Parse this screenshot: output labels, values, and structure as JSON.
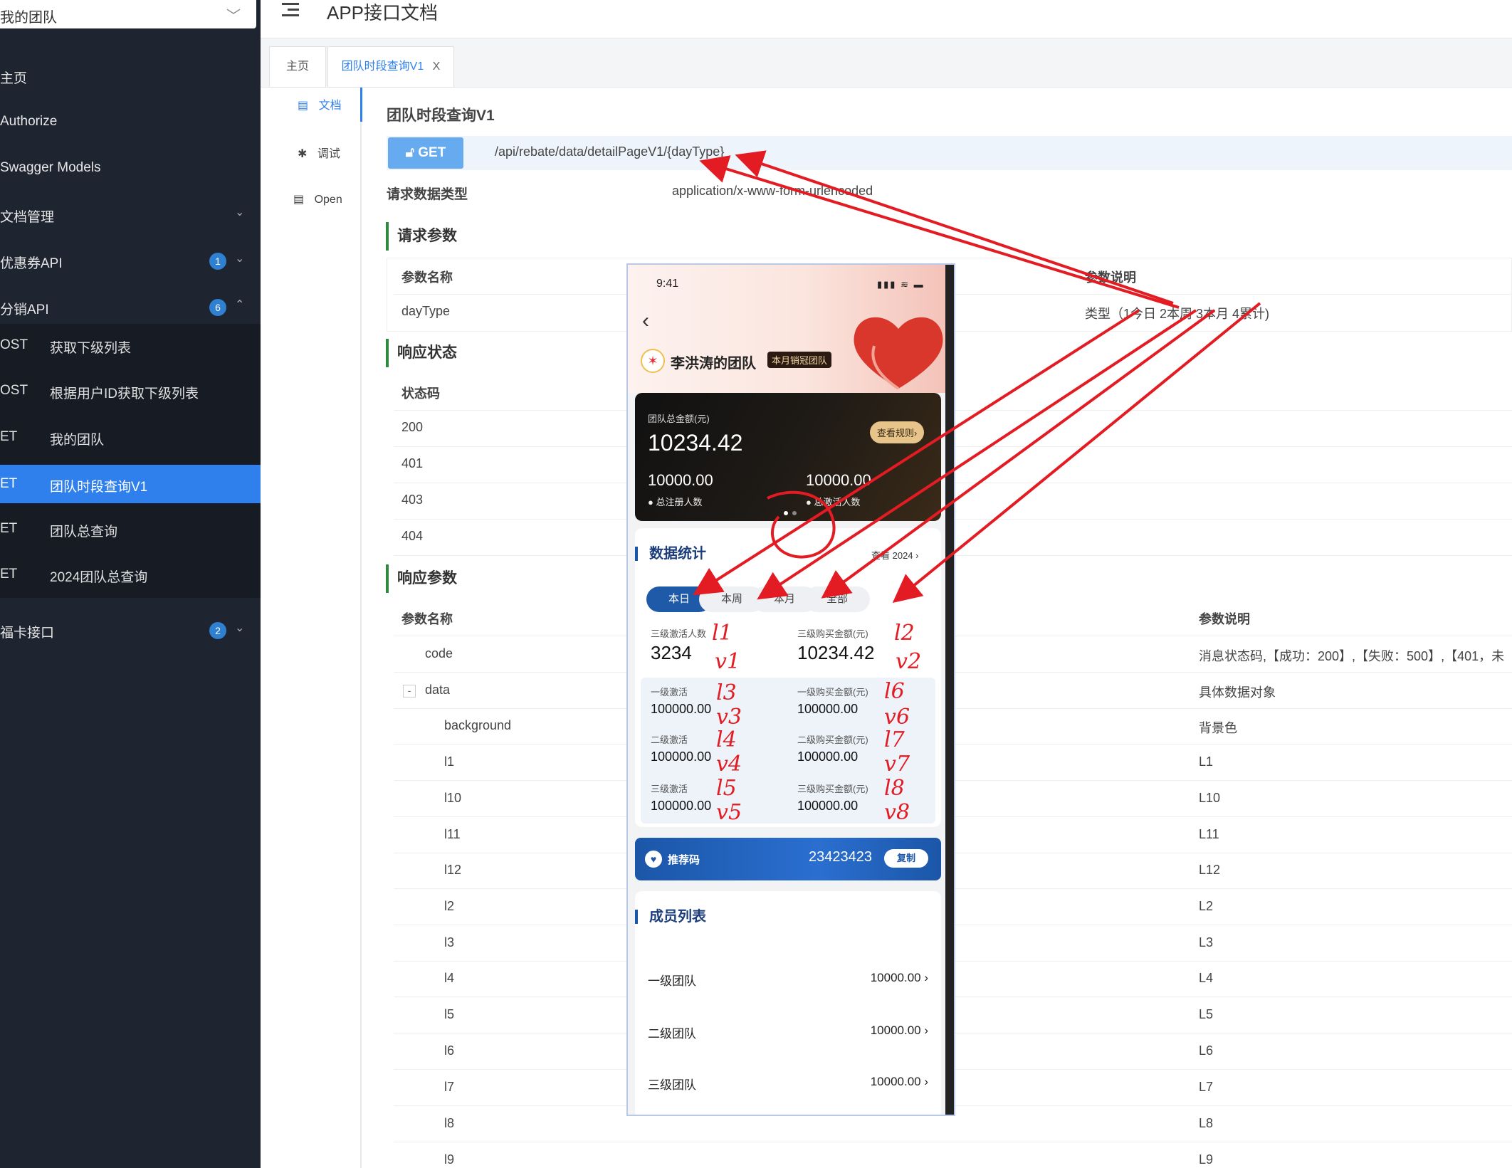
{
  "sidebar": {
    "team_select": "我的团队",
    "items": [
      {
        "label": "主页"
      },
      {
        "label": "Authorize"
      },
      {
        "label": "Swagger Models"
      },
      {
        "label": "文档管理"
      },
      {
        "label": "优惠券API",
        "badge": "1"
      },
      {
        "label": "分销API",
        "badge": "6"
      },
      {
        "label": "福卡接口",
        "badge": "2"
      }
    ],
    "sub_items": [
      {
        "method": "OST",
        "label": "获取下级列表"
      },
      {
        "method": "OST",
        "label": "根据用户ID获取下级列表"
      },
      {
        "method": "ET",
        "label": "我的团队"
      },
      {
        "method": "ET",
        "label": "团队时段查询V1"
      },
      {
        "method": "ET",
        "label": "团队总查询"
      },
      {
        "method": "ET",
        "label": "2024团队总查询"
      }
    ]
  },
  "header": {
    "title": "APP接口文档"
  },
  "tabs": [
    {
      "label": "主页"
    },
    {
      "label": "团队时段查询V1"
    }
  ],
  "tab_close": "X",
  "doc_menu": [
    {
      "icon": "▤",
      "label": "文档"
    },
    {
      "icon": "✱",
      "label": "调试"
    },
    {
      "icon": "▤",
      "label": "Open"
    }
  ],
  "main": {
    "title": "团队时段查询V1",
    "method": "GET",
    "url": "/api/rebate/data/detailPageV1/{dayType}",
    "req_type_label": "请求数据类型",
    "req_type_value": "application/x-www-form-urlencoded",
    "req_params_title": "请求参数",
    "req_headers": [
      "参数名称",
      "参数说明"
    ],
    "req_rows": [
      {
        "name": "dayType",
        "desc": "类型（1今日 2本周 3本月 4累计)"
      }
    ],
    "status_title": "响应状态",
    "status_header": "状态码",
    "status_codes": [
      "200",
      "401",
      "403",
      "404"
    ],
    "resp_title": "响应参数",
    "resp_headers": [
      "参数名称",
      "参数说明"
    ],
    "resp_rows": [
      {
        "name": "code",
        "desc": "消息状态码,【成功：200】,【失败：500】,【401，未"
      },
      {
        "name": "data",
        "desc": "具体数据对象"
      },
      {
        "name": "background",
        "desc": "背景色"
      },
      {
        "name": "l1",
        "desc": "L1"
      },
      {
        "name": "l10",
        "desc": "L10"
      },
      {
        "name": "l11",
        "desc": "L11"
      },
      {
        "name": "l12",
        "desc": "L12"
      },
      {
        "name": "l2",
        "desc": "L2"
      },
      {
        "name": "l3",
        "desc": "L3"
      },
      {
        "name": "l4",
        "desc": "L4"
      },
      {
        "name": "l5",
        "desc": "L5"
      },
      {
        "name": "l6",
        "desc": "L6"
      },
      {
        "name": "l7",
        "desc": "L7"
      },
      {
        "name": "l8",
        "desc": "L8"
      },
      {
        "name": "l9",
        "desc": "L9"
      }
    ]
  },
  "phone": {
    "time": "9:41",
    "status": "▮▮▮ ≋ ▬",
    "team_name": "李洪涛的团队",
    "team_badge": "本月销冠团队",
    "total_label": "团队总金额(元)",
    "total_value": "10234.42",
    "rule_btn": "查看规则›",
    "reg_value": "10000.00",
    "reg_label": "总注册人数",
    "act_value": "10000.00",
    "act_label": "总激活人数",
    "stats_title": "数据统计",
    "see_year": "查看 2024 ›",
    "periods": [
      "本日",
      "本周",
      "本月",
      "全部"
    ],
    "lvl3_act_label": "三级激活人数",
    "lvl3_act_value": "3234",
    "lvl3_buy_label": "三级购买金额(元)",
    "lvl3_buy_value": "10234.42",
    "sub_stats": [
      {
        "label": "一级激活",
        "value": "100000.00"
      },
      {
        "label": "一级购买金额(元)",
        "value": "100000.00"
      },
      {
        "label": "二级激活",
        "value": "100000.00"
      },
      {
        "label": "二级购买金额(元)",
        "value": "100000.00"
      },
      {
        "label": "三级激活",
        "value": "100000.00"
      },
      {
        "label": "三级购买金额(元)",
        "value": "100000.00"
      }
    ],
    "ref_label": "推荐码",
    "ref_code": "23423423",
    "copy_btn": "复制",
    "members_title": "成员列表",
    "members": [
      {
        "name": "一级团队",
        "value": "10000.00 ›"
      },
      {
        "name": "二级团队",
        "value": "10000.00 ›"
      },
      {
        "name": "三级团队",
        "value": "10000.00 ›"
      }
    ]
  },
  "annotations": [
    "l1",
    "v1",
    "l2",
    "v2",
    "l3",
    "v3",
    "l6",
    "v6",
    "l4",
    "v4",
    "l7",
    "v7",
    "l5",
    "v5",
    "l8",
    "v8"
  ],
  "colors": {
    "accent": "#2f80ed",
    "sidebar": "#1f2530",
    "annotation": "#e31b23"
  }
}
